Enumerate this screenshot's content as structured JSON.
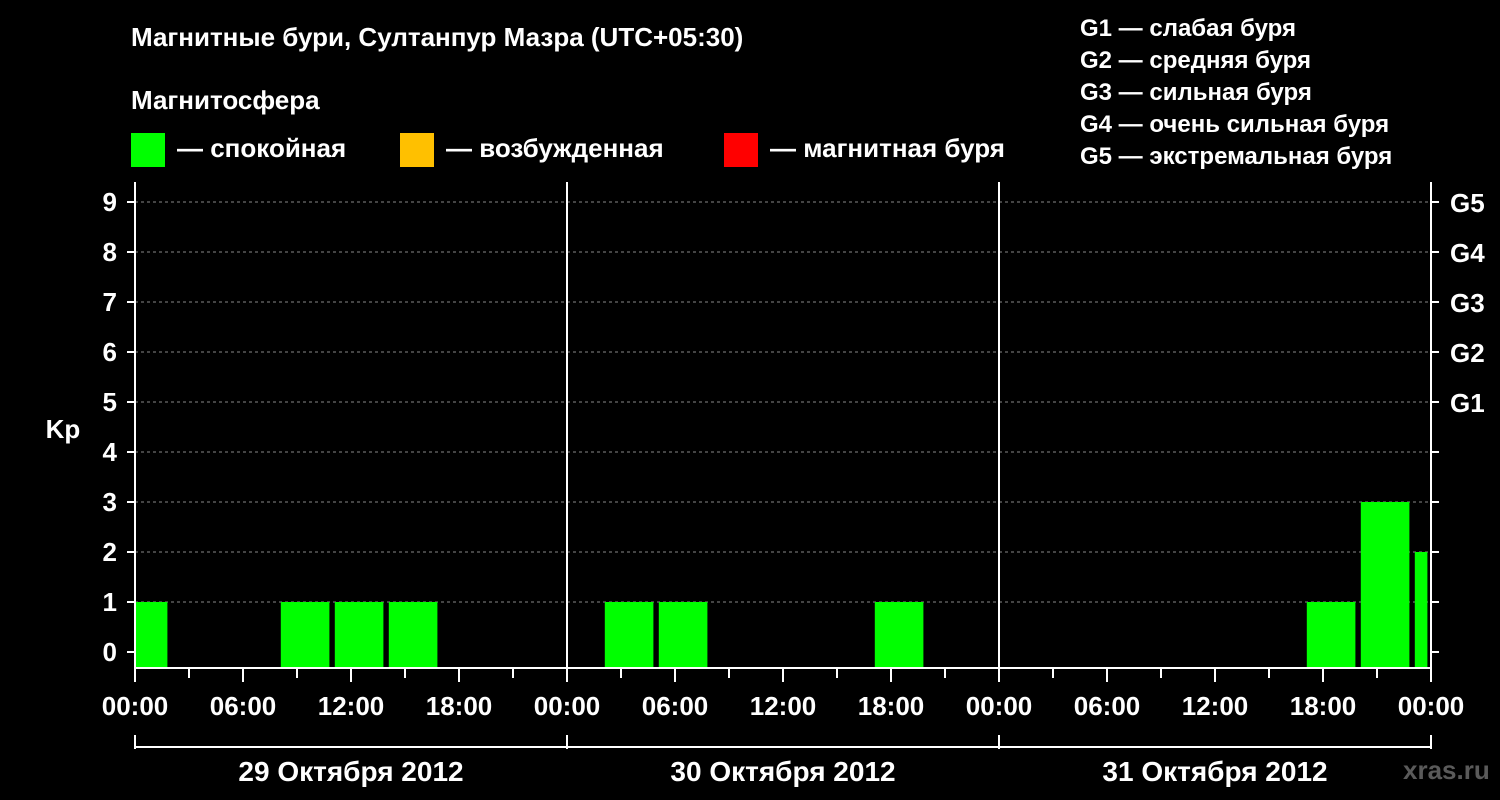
{
  "header": {
    "title": "Магнитные бури, Султанпур Мазра (UTC+05:30)",
    "subtitle": "Магнитосфера"
  },
  "legend": [
    {
      "color": "#00ff00",
      "label": "— спокойная"
    },
    {
      "color": "#ffc000",
      "label": "— возбужденная"
    },
    {
      "color": "#ff0000",
      "label": "— магнитная буря"
    }
  ],
  "g_scale": [
    "G1 — слабая буря",
    "G2 — средняя буря",
    "G3 — сильная буря",
    "G4 — очень сильная буря",
    "G5 — экстремальная буря"
  ],
  "watermark": "xras.ru",
  "chart_data": {
    "type": "bar",
    "ylabel": "Kp",
    "ylim": [
      0,
      9
    ],
    "yticks": [
      "0",
      "1",
      "2",
      "3",
      "4",
      "5",
      "6",
      "7",
      "8",
      "9"
    ],
    "right_ticks": [
      {
        "kp": 5,
        "label": "G1"
      },
      {
        "kp": 6,
        "label": "G2"
      },
      {
        "kp": 7,
        "label": "G3"
      },
      {
        "kp": 8,
        "label": "G4"
      },
      {
        "kp": 9,
        "label": "G5"
      }
    ],
    "xtick_labels": [
      "00:00",
      "06:00",
      "12:00",
      "18:00",
      "00:00",
      "06:00",
      "12:00",
      "18:00",
      "00:00",
      "06:00",
      "12:00",
      "18:00",
      "00:00"
    ],
    "days": [
      "29 Октября 2012",
      "30 Октября 2012",
      "31 Октября 2012"
    ],
    "grid": true,
    "series": [
      {
        "bars": [
          {
            "start_hour": 0,
            "end_hour": 1.8,
            "kp": 1
          },
          {
            "start_hour": 8.1,
            "end_hour": 10.8,
            "kp": 1
          },
          {
            "start_hour": 11.1,
            "end_hour": 13.8,
            "kp": 1
          },
          {
            "start_hour": 14.1,
            "end_hour": 16.8,
            "kp": 1
          },
          {
            "start_hour": 26.1,
            "end_hour": 28.8,
            "kp": 1
          },
          {
            "start_hour": 29.1,
            "end_hour": 31.8,
            "kp": 1
          },
          {
            "start_hour": 41.1,
            "end_hour": 43.8,
            "kp": 1
          },
          {
            "start_hour": 65.1,
            "end_hour": 67.8,
            "kp": 1
          },
          {
            "start_hour": 68.1,
            "end_hour": 70.8,
            "kp": 3
          },
          {
            "start_hour": 71.1,
            "end_hour": 71.8,
            "kp": 2
          }
        ]
      }
    ]
  }
}
